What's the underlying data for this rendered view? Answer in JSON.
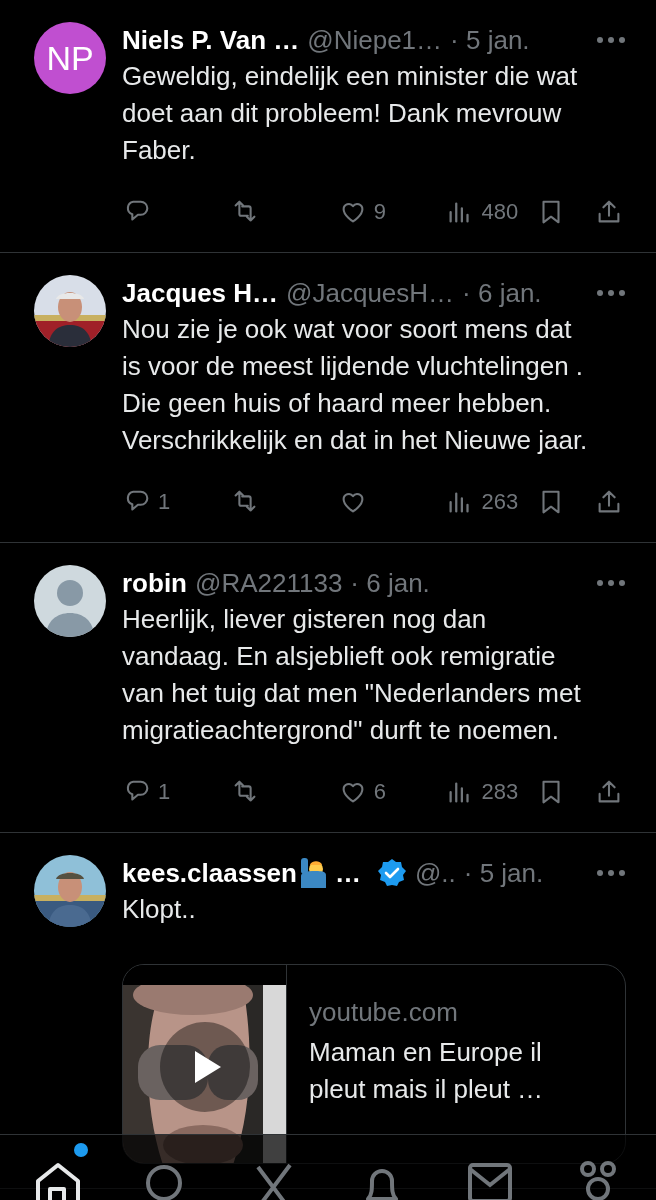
{
  "tweets": [
    {
      "avatar": {
        "kind": "initials",
        "initials": "NP",
        "color": "#c04fd0"
      },
      "name": "Niels P. Van …",
      "handle": "@Niepe1…",
      "time": "· 5 jan.",
      "text": "Geweldig, eindelijk een minister die wat doet aan dit probleem! Dank mevrouw Faber.",
      "stats": {
        "likes": "9",
        "views": "480"
      }
    },
    {
      "name": "Jacques H…",
      "handle": "@JacquesH…",
      "time": "· 6 jan.",
      "text": "Nou zie je ook wat voor soort mens dat is voor de meest lijdende vluchtelingen . Die geen huis of haard meer hebben. Verschrikkelijk en dat in het Nieuwe jaar.",
      "stats": {
        "replies": "1",
        "views": "263"
      }
    },
    {
      "avatar": {
        "kind": "default"
      },
      "name": "robin",
      "handle": "@RA221133",
      "time": "· 6 jan.",
      "text": "Heerlijk, liever gisteren nog dan vandaag. En alsjeblieft ook remigratie van het tuig dat men \"Nederlanders met migratieachtergrond\" durft te noemen.",
      "stats": {
        "replies": "1",
        "likes": "6",
        "views": "283"
      }
    },
    {
      "name": "kees.claassen",
      "name_end": "…",
      "handle": "@..",
      "time": "· 5 jan.",
      "verified": true,
      "text": "Klopt..",
      "link_card": {
        "domain": "youtube.com",
        "title": "Maman en Europe il pleut mais il pleut …"
      }
    }
  ],
  "bottom_nav": [
    {
      "kind": "home",
      "selected": true,
      "badge": true
    },
    {
      "kind": "search",
      "selected": false
    },
    {
      "kind": "grok",
      "selected": false
    },
    {
      "kind": "bell",
      "selected": false
    },
    {
      "kind": "mail",
      "selected": false
    },
    {
      "kind": "people",
      "selected": false
    }
  ]
}
